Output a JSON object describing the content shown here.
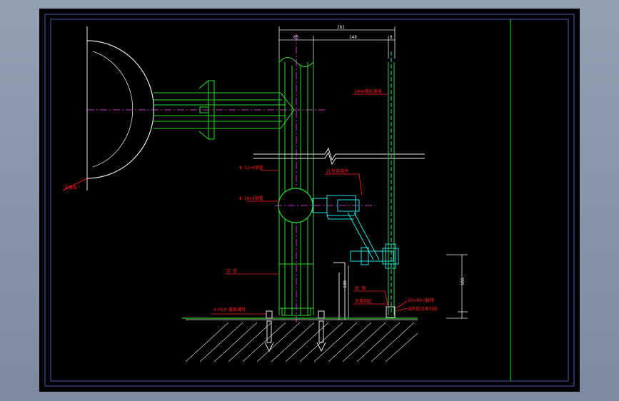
{
  "drawing": {
    "dimensions": {
      "total_width": "281",
      "left_part": "65",
      "middle_part": "148",
      "right_part": "8",
      "height_right": "165",
      "height_left": "100"
    },
    "labels": {
      "glass_panel": "10mm钢化玻璃",
      "pipe_upper": "Φ 52×4钢管",
      "pipe_middle": "Φ 50×4钢管",
      "connector": "ZL型连接件",
      "left_stand": "支撑架",
      "post": "立 柱",
      "anchor_bolt": "4-M10 膨胀螺栓",
      "rib": "肋 板",
      "fixing": "驳接固定",
      "plate": "10×40×3扁钢",
      "foam": "结构胶及密封胶"
    }
  },
  "colors": {
    "canvas": "#000000",
    "frame": "#4a5ab0",
    "green": "#2fd82f",
    "cyan": "#20e0e0",
    "red": "#ff2020",
    "magenta": "#ff40ff",
    "white": "#e8e8e8"
  }
}
